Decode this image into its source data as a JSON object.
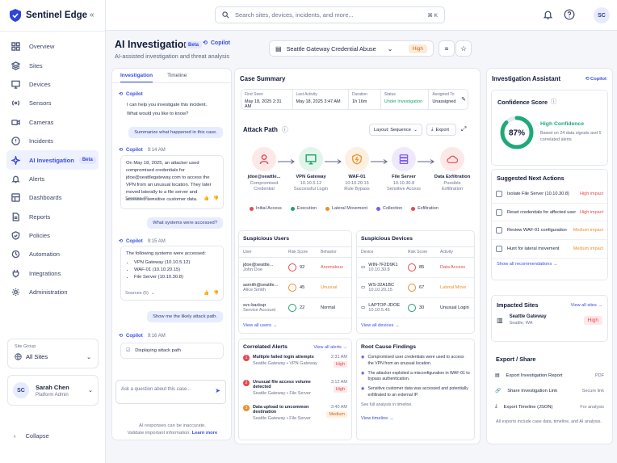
{
  "brand": {
    "name": "Sentinel Edge"
  },
  "nav": {
    "items": [
      {
        "label": "Overview"
      },
      {
        "label": "Sites"
      },
      {
        "label": "Devices"
      },
      {
        "label": "Sensors"
      },
      {
        "label": "Cameras"
      },
      {
        "label": "Incidents"
      },
      {
        "label": "AI Investigation",
        "badge": "Beta"
      },
      {
        "label": "Alerts"
      },
      {
        "label": "Dashboards"
      },
      {
        "label": "Reports"
      },
      {
        "label": "Policies"
      },
      {
        "label": "Automation"
      },
      {
        "label": "Integrations"
      },
      {
        "label": "Administration"
      }
    ],
    "site_group_label": "Site Group",
    "site_group_value": "All Sites",
    "user": {
      "initials": "SC",
      "name": "Sarah Chen",
      "role": "Platform Admin"
    },
    "collapse_label": "Collapse"
  },
  "topbar": {
    "search_placeholder": "Search sites, devices, incidents, and more...",
    "shortcut": "⌘ K",
    "avatar": "SC"
  },
  "header": {
    "title": "AI Investigation",
    "beta": "Beta",
    "copilot": "Copilot",
    "subtitle": "AI-assisted investigation and threat analysis",
    "incident": "Seattle Gateway Credential Abuse",
    "severity": "High"
  },
  "chat": {
    "tabs": [
      "Investigation",
      "Timeline"
    ],
    "copilot": "Copilot",
    "greeting_1": "I can help you investigate this incident.",
    "greeting_2": "What would you like to know?",
    "q1": "Summarize what happened in this case.",
    "a1_time": "9:14 AM",
    "a1_text": "On May 18, 2025, an attacker used compromised credentials for jdoe@seattlegateway.com to access the VPN from an unusual location. They later moved laterally to a file server and accessed sensitive customer data.",
    "a1_sources": "Sources (9)",
    "q2": "What systems were accessed?",
    "a2_time": "9:15 AM",
    "a2_intro": "The following systems were accessed:",
    "a2_items": [
      "VPN Gateway (10.10.5.12)",
      "WAF-01 (10.10.20.15)",
      "File Server (10.10.30.8)"
    ],
    "a2_sources": "Sources (5)",
    "q3": "Show me the likely attack path.",
    "a3_time": "9:16 AM",
    "a3_text": "Displaying attack path",
    "input_placeholder": "Ask a question about this case...",
    "disclaimer_1": "AI responses can be inaccurate.",
    "disclaimer_2": "Validate important information.",
    "learn_more": "Learn more"
  },
  "case": {
    "title": "Case Summary",
    "fields": [
      {
        "label": "First Seen",
        "value": "May 18, 2025 2:31 AM"
      },
      {
        "label": "Last Activity",
        "value": "May 18, 2025 3:47 AM"
      },
      {
        "label": "Duration",
        "value": "1h 16m"
      },
      {
        "label": "Status",
        "value": "Under Investigation"
      },
      {
        "label": "Assigned To",
        "value": "Unassigned"
      }
    ],
    "attack_path_title": "Attack Path",
    "layout_label": "Layout: Sequence",
    "export_label": "Export",
    "nodes": [
      {
        "n1": "jdoe@seattle...",
        "n2": "Compromised",
        "n3": "Credential"
      },
      {
        "n1": "VPN Gateway",
        "n2": "10.10.5.12",
        "n3": "Successful Login"
      },
      {
        "n1": "WAF-01",
        "n2": "10.10.20.15",
        "n3": "Rule Bypass"
      },
      {
        "n1": "File Server",
        "n2": "10.10.30.8",
        "n3": "Sensitive Access"
      },
      {
        "n1": "Data Exfiltration",
        "n2": "Possible",
        "n3": "Exfiltration"
      }
    ],
    "legend": [
      {
        "label": "Initial Access",
        "color": "#e5484d"
      },
      {
        "label": "Execution",
        "color": "#22a06b"
      },
      {
        "label": "Lateral Movement",
        "color": "#f08c2a"
      },
      {
        "label": "Collection",
        "color": "#7a5af8"
      },
      {
        "label": "Exfiltration",
        "color": "#e5484d"
      }
    ]
  },
  "users": {
    "title": "Suspicious Users",
    "headers": [
      "User",
      "Risk Score",
      "Behavior"
    ],
    "rows": [
      {
        "name": "jdoe@seattle...",
        "sub": "John Doe",
        "score": "92",
        "behavior": "Anomalous",
        "color": "#e5484d"
      },
      {
        "name": "asmith@seattle...",
        "sub": "Alice Smith",
        "score": "45",
        "behavior": "Unusual",
        "color": "#f08c2a"
      },
      {
        "name": "svc-backup",
        "sub": "Service Account",
        "score": "22",
        "behavior": "Normal",
        "color": "#22a06b"
      }
    ],
    "view_all": "View all users"
  },
  "devices": {
    "title": "Suspicious Devices",
    "headers": [
      "Device",
      "Risk Score",
      "Activity"
    ],
    "rows": [
      {
        "name": "WIN-7F2D9K1",
        "sub": "10.10.30.8",
        "score": "85",
        "activity": "Data Access",
        "color": "#e5484d"
      },
      {
        "name": "WS-32A1BC",
        "sub": "10.10.20.15",
        "score": "67",
        "activity": "Lateral Move",
        "color": "#f08c2a"
      },
      {
        "name": "LAPTOP-JDOE",
        "sub": "10.10.5.45",
        "score": "30",
        "activity": "Unusual Login",
        "color": "#22a06b"
      }
    ],
    "view_all": "View all devices"
  },
  "alerts": {
    "title": "Correlated Alerts",
    "count_link": "View all alerts",
    "rows": [
      {
        "n": "1",
        "title": "Multiple failed login attempts",
        "sub": "Seattle Gateway • VPN Gateway",
        "time": "2:31 AM",
        "sev": "High",
        "color": "#e5484d"
      },
      {
        "n": "2",
        "title": "Unusual file access volume detected",
        "sub": "Seattle Gateway • File Server",
        "time": "3:12 AM",
        "sev": "High",
        "color": "#e5484d"
      },
      {
        "n": "3",
        "title": "Data upload to uncommon destination",
        "sub": "Seattle Gateway • File Server",
        "time": "3:40 AM",
        "sev": "Medium",
        "color": "#f08c2a"
      }
    ]
  },
  "root": {
    "title": "Root Cause Findings",
    "items": [
      "Compromised user credentials were used to access the VPN from an unusual location.",
      "The attacker exploited a misconfiguration in WAF-01 to bypass authentication.",
      "Sensitive customer data was accessed and potentially exfiltrated to an external IP."
    ],
    "timeline_note": "See full analysis in timeline.",
    "view_timeline": "View timeline"
  },
  "assistant": {
    "title": "Investigation Assistant",
    "copilot": "Copilot",
    "confidence_title": "Confidence Score",
    "confidence_value": "87%",
    "confidence_fraction": 0.87,
    "confidence_label": "High Confidence",
    "confidence_note": "Based on 24 data signals and 5 correlated alerts",
    "next_title": "Suggested Next Actions",
    "actions": [
      {
        "label": "Isolate File Server (10.10.30.8)",
        "impact": "High impact",
        "color": "#e5484d"
      },
      {
        "label": "Reset credentials for affected user",
        "impact": "High impact",
        "color": "#e5484d"
      },
      {
        "label": "Review WAF-01 configuration",
        "impact": "Medium impact",
        "color": "#f08c2a"
      },
      {
        "label": "Hunt for lateral movement",
        "impact": "Medium impact",
        "color": "#f08c2a"
      }
    ],
    "show_all": "Show all recommendations",
    "sites_title": "Impacted Sites",
    "view_all_sites": "View all sites",
    "site_name": "Seattle Gateway",
    "site_loc": "Seattle, WA",
    "site_sev": "High",
    "export_title": "Export / Share",
    "exports": [
      {
        "label": "Export Investigation Report",
        "right": "PDF"
      },
      {
        "label": "Share Investigation Link",
        "right": "Secure link"
      },
      {
        "label": "Export Timeline (JSON)",
        "right": "For analysis"
      }
    ],
    "export_note": "All exports include case data, timeline, and AI analysis."
  }
}
